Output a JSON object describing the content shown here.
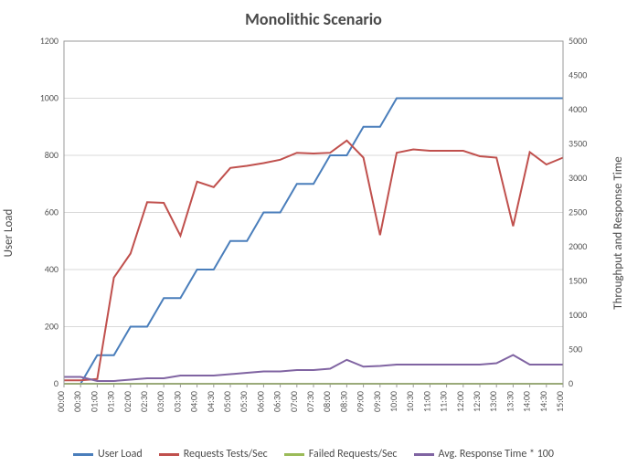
{
  "chart_data": {
    "type": "line",
    "title": "Monolithic Scenario",
    "y1_label": "User Load",
    "y2_label": "Throughput and Response Time",
    "y1_lim": [
      0,
      1200
    ],
    "y2_lim": [
      0,
      5000
    ],
    "y1_ticks": [
      0,
      200,
      400,
      600,
      800,
      1000,
      1200
    ],
    "y2_ticks": [
      0,
      500,
      1000,
      1500,
      2000,
      2500,
      3000,
      3500,
      4000,
      4500,
      5000
    ],
    "categories": [
      "00:00",
      "00:30",
      "01:00",
      "01:30",
      "02:00",
      "02:30",
      "03:00",
      "03:30",
      "04:00",
      "04:30",
      "05:00",
      "05:30",
      "06:00",
      "06:30",
      "07:00",
      "07:30",
      "08:00",
      "08:30",
      "09:00",
      "09:30",
      "10:00",
      "10:30",
      "11:00",
      "11:30",
      "12:00",
      "12:30",
      "13:00",
      "13:30",
      "14:00",
      "14:30",
      "15:00"
    ],
    "series": [
      {
        "name": "User Load",
        "axis": "y1",
        "color": "#4a7ebb",
        "values": [
          0,
          0,
          100,
          100,
          200,
          200,
          300,
          300,
          400,
          400,
          500,
          500,
          600,
          600,
          700,
          700,
          800,
          800,
          900,
          900,
          1000,
          1000,
          1000,
          1000,
          1000,
          1000,
          1000,
          1000,
          1000,
          1000,
          1000
        ]
      },
      {
        "name": "Requests Tests/Sec",
        "axis": "y2",
        "color": "#c0504d",
        "values": [
          50,
          50,
          70,
          1550,
          1900,
          2650,
          2640,
          2160,
          2950,
          2870,
          3150,
          3180,
          3220,
          3270,
          3370,
          3360,
          3370,
          3550,
          3300,
          2170,
          3370,
          3420,
          3400,
          3400,
          3400,
          3320,
          3300,
          2300,
          3380,
          3200,
          3300
        ]
      },
      {
        "name": "Failed Requests/Sec",
        "axis": "y2",
        "color": "#9bbb59",
        "values": [
          0,
          0,
          0,
          0,
          0,
          0,
          0,
          0,
          0,
          0,
          0,
          0,
          0,
          0,
          0,
          0,
          0,
          0,
          0,
          0,
          0,
          0,
          0,
          0,
          0,
          0,
          0,
          0,
          0,
          0,
          0
        ]
      },
      {
        "name": "Avg. Response Time * 100",
        "axis": "y2",
        "color": "#8064a2",
        "values": [
          100,
          100,
          40,
          40,
          60,
          80,
          80,
          120,
          120,
          120,
          140,
          160,
          180,
          180,
          200,
          200,
          220,
          350,
          250,
          260,
          280,
          280,
          280,
          280,
          280,
          280,
          300,
          420,
          280,
          280,
          280
        ]
      }
    ],
    "legend": {
      "items": [
        "User Load",
        "Requests Tests/Sec",
        "Failed Requests/Sec",
        "Avg. Response Time * 100"
      ]
    }
  }
}
